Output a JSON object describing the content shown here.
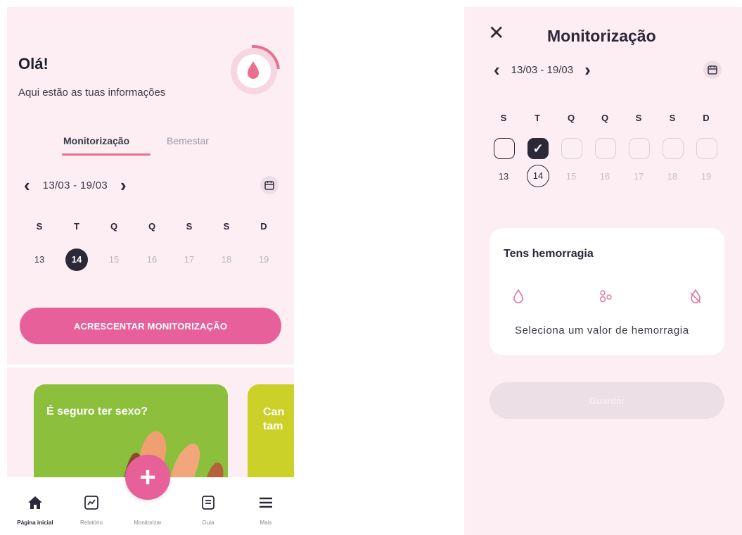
{
  "home": {
    "greeting": "Olá!",
    "subtitle": "Aqui estão as tuas informações",
    "tabs": [
      {
        "label": "Monitorização",
        "active": true
      },
      {
        "label": "Bemestar",
        "active": false
      }
    ],
    "week": {
      "range": "13/03 - 19/03",
      "day_initials": [
        "S",
        "T",
        "Q",
        "Q",
        "S",
        "S",
        "D"
      ],
      "days": [
        "13",
        "14",
        "15",
        "16",
        "17",
        "18",
        "19"
      ],
      "today_index": 1
    },
    "add_tracking_label": "ACRESCENTAR MONITORIZAÇÃO",
    "cards": [
      {
        "title": "É seguro ter sexo?",
        "color": "#8cbf3c"
      },
      {
        "title": "Can\ntam",
        "color": "#cbd128"
      }
    ],
    "bottom_nav": [
      {
        "label": "Página inicial",
        "icon": "home-icon",
        "active": true
      },
      {
        "label": "Relatório",
        "icon": "chart-icon",
        "active": false
      },
      {
        "label": "Monitorizar",
        "icon": "plus-icon",
        "active": false
      },
      {
        "label": "Guia",
        "icon": "guide-icon",
        "active": false
      },
      {
        "label": "Mais",
        "icon": "menu-icon",
        "active": false
      }
    ]
  },
  "tracking": {
    "title": "Monitorização",
    "week": {
      "range": "13/03 - 19/03",
      "day_initials": [
        "S",
        "T",
        "Q",
        "Q",
        "S",
        "S",
        "D"
      ],
      "days": [
        "13",
        "14",
        "15",
        "16",
        "17",
        "18",
        "19"
      ],
      "checked_index": 1,
      "today_index": 1
    },
    "question": "Tens hemorragia",
    "options_icons": [
      "drop-outline-icon",
      "spotting-icon",
      "no-drop-icon"
    ],
    "hint": "Seleciona um valor de hemorragia",
    "save_label": "Guardar"
  },
  "colors": {
    "background": "#fdeef3",
    "accent": "#e7609a",
    "dark": "#2b2838",
    "underline": "#e9708f"
  }
}
